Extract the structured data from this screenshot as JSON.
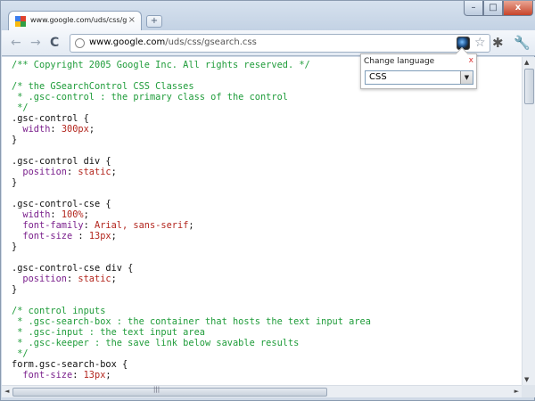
{
  "browser": {
    "tab_title": "www.google.com/uds/css/gsea...",
    "tab_close": "×",
    "new_tab": "+",
    "window_minimize": "–",
    "window_maximize": "□",
    "window_close": "x",
    "nav": {
      "back": "←",
      "forward": "→",
      "reload": "C"
    },
    "url_host": "www.google.com",
    "url_path": "/uds/css/gsearch.css",
    "icons": [
      "back-arrow-icon",
      "forward-arrow-icon",
      "reload-icon",
      "page-icon",
      "extension-icon",
      "star-icon",
      "bug-icon",
      "wrench-icon"
    ],
    "star": "☆",
    "bug": "✱",
    "wrench": "🔧"
  },
  "popup": {
    "title": "Change language",
    "close": "x",
    "selected_language": "CSS",
    "dropdown_arrow": "▼"
  },
  "code_lines": [
    [
      {
        "c": "comment",
        "t": "/** Copyright 2005 Google Inc. All rights reserved. */"
      }
    ],
    [],
    [
      {
        "c": "comment",
        "t": "/* the GSearchControl CSS Classes"
      }
    ],
    [
      {
        "c": "comment",
        "t": " * .gsc-control : the primary class of the control"
      }
    ],
    [
      {
        "c": "comment",
        "t": " */"
      }
    ],
    [
      {
        "c": "text",
        "t": ".gsc-control {"
      }
    ],
    [
      {
        "c": "prop",
        "t": "  width"
      },
      {
        "c": "text",
        "t": ": "
      },
      {
        "c": "val",
        "t": "300px"
      },
      {
        "c": "text",
        "t": ";"
      }
    ],
    [
      {
        "c": "text",
        "t": "}"
      }
    ],
    [],
    [
      {
        "c": "text",
        "t": ".gsc-control div {"
      }
    ],
    [
      {
        "c": "prop",
        "t": "  position"
      },
      {
        "c": "text",
        "t": ": "
      },
      {
        "c": "val",
        "t": "static"
      },
      {
        "c": "text",
        "t": ";"
      }
    ],
    [
      {
        "c": "text",
        "t": "}"
      }
    ],
    [],
    [
      {
        "c": "text",
        "t": ".gsc-control-cse {"
      }
    ],
    [
      {
        "c": "prop",
        "t": "  width"
      },
      {
        "c": "text",
        "t": ": "
      },
      {
        "c": "val",
        "t": "100%"
      },
      {
        "c": "text",
        "t": ";"
      }
    ],
    [
      {
        "c": "prop",
        "t": "  font-family"
      },
      {
        "c": "text",
        "t": ": "
      },
      {
        "c": "val",
        "t": "Arial, sans-serif"
      },
      {
        "c": "text",
        "t": ";"
      }
    ],
    [
      {
        "c": "prop",
        "t": "  font-size"
      },
      {
        "c": "text",
        "t": " : "
      },
      {
        "c": "val",
        "t": "13px"
      },
      {
        "c": "text",
        "t": ";"
      }
    ],
    [
      {
        "c": "text",
        "t": "}"
      }
    ],
    [],
    [
      {
        "c": "text",
        "t": ".gsc-control-cse div {"
      }
    ],
    [
      {
        "c": "prop",
        "t": "  position"
      },
      {
        "c": "text",
        "t": ": "
      },
      {
        "c": "val",
        "t": "static"
      },
      {
        "c": "text",
        "t": ";"
      }
    ],
    [
      {
        "c": "text",
        "t": "}"
      }
    ],
    [],
    [
      {
        "c": "comment",
        "t": "/* control inputs"
      }
    ],
    [
      {
        "c": "comment",
        "t": " * .gsc-search-box : the container that hosts the text input area"
      }
    ],
    [
      {
        "c": "comment",
        "t": " * .gsc-input : the text input area"
      }
    ],
    [
      {
        "c": "comment",
        "t": " * .gsc-keeper : the save link below savable results"
      }
    ],
    [
      {
        "c": "comment",
        "t": " */"
      }
    ],
    [
      {
        "c": "text",
        "t": "form.gsc-search-box {"
      }
    ],
    [
      {
        "c": "prop",
        "t": "  font-size"
      },
      {
        "c": "text",
        "t": ": "
      },
      {
        "c": "val",
        "t": "13px"
      },
      {
        "c": "text",
        "t": ";"
      }
    ]
  ],
  "scrollbar": {
    "up": "▲",
    "down": "▼",
    "left": "◄",
    "right": "►",
    "grip": "|||"
  }
}
